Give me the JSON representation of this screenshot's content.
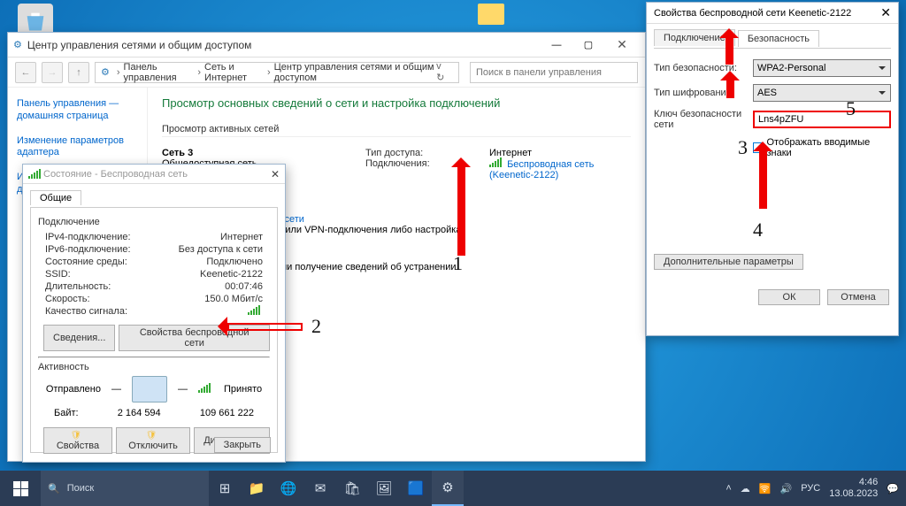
{
  "desktop": {
    "recycle_bin": "Корзина"
  },
  "netcenter": {
    "title": "Центр управления сетями и общим доступом",
    "breadcrumb": [
      "Панель управления",
      "Сеть и Интернет",
      "Центр управления сетями и общим доступом"
    ],
    "search_placeholder": "Поиск в панели управления",
    "sidebar_links": [
      "Панель управления — домашняя страница",
      "Изменение параметров адаптера",
      "Изменить дополнительные"
    ],
    "heading": "Просмотр основных сведений о сети и настройка подключений",
    "active_networks_lbl": "Просмотр активных сетей",
    "net_name": "Сеть 3",
    "net_type": "Общедоступная сеть",
    "access_lbl": "Тип доступа:",
    "access_val": "Интернет",
    "conn_lbl": "Подключения:",
    "conn_val_1": "Беспроводная сеть",
    "conn_val_2": "(Keenetic-2122)",
    "change_hdr": "я нового подключения или сети",
    "change_line_1": "олосного, коммутируемого или VPN-подключения либо настройка",
    "change_line_2": "и точки доступа.",
    "trouble_line": "вление проблем с сетью или получение сведений об устранении"
  },
  "status": {
    "title": "Состояние - Беспроводная сеть",
    "tab": "Общие",
    "grp_conn": "Подключение",
    "rows": [
      [
        "IPv4-подключение:",
        "Интернет"
      ],
      [
        "IPv6-подключение:",
        "Без доступа к сети"
      ],
      [
        "Состояние среды:",
        "Подключено"
      ],
      [
        "SSID:",
        "Keenetic-2122"
      ],
      [
        "Длительность:",
        "00:07:46"
      ],
      [
        "Скорость:",
        "150.0 Мбит/с"
      ],
      [
        "Качество сигнала:",
        ""
      ]
    ],
    "btn_details": "Сведения...",
    "btn_wprops": "Свойства беспроводной сети",
    "grp_activity": "Активность",
    "sent_lbl": "Отправлено",
    "recv_lbl": "Принято",
    "bytes_lbl": "Байт:",
    "bytes_sent": "2 164 594",
    "bytes_recv": "109 661 222",
    "btn_props": "Свойства",
    "btn_disable": "Отключить",
    "btn_diag": "Диагностика",
    "btn_close": "Закрыть"
  },
  "props": {
    "title": "Свойства беспроводной сети Keenetic-2122",
    "tab_conn": "Подключение",
    "tab_sec": "Безопасность",
    "sec_type_lbl": "Тип безопасности:",
    "sec_type_val": "WPA2-Personal",
    "enc_lbl": "Тип шифрования:",
    "enc_val": "AES",
    "key_lbl": "Ключ безопасности сети",
    "key_val": "Lns4pZFU",
    "showchars": "Отображать вводимые знаки",
    "adv": "Дополнительные параметры",
    "ok": "ОК",
    "cancel": "Отмена"
  },
  "anno": {
    "n1": "1",
    "n2": "2",
    "n3": "3",
    "n4": "4",
    "n5": "5"
  },
  "taskbar": {
    "search": "Поиск",
    "lang": "РУС",
    "time": "4:46",
    "date": "13.08.2023"
  }
}
